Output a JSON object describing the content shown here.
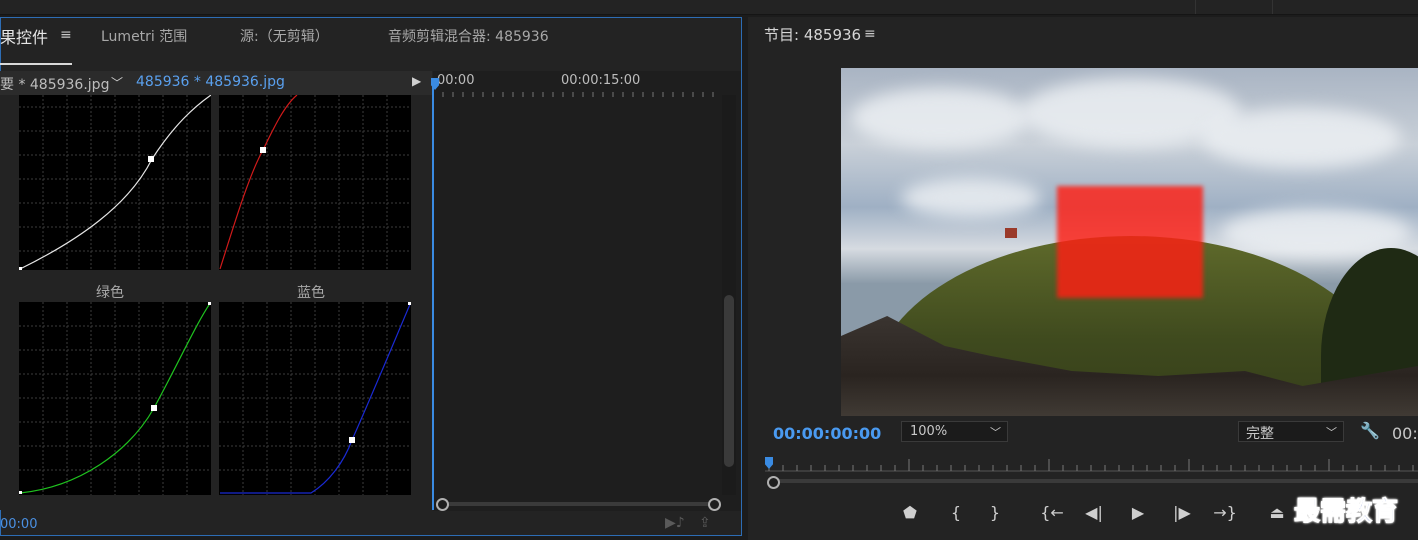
{
  "left_panel": {
    "tabs": [
      {
        "label": "果控件",
        "active": true
      },
      {
        "label": "Lumetri 范围"
      },
      {
        "label": "源:（无剪辑）"
      },
      {
        "label": "音频剪辑混合器: 485936"
      }
    ],
    "menu_icon": "≡",
    "clip_master": "要 * 485936.jpg",
    "clip_sequence": "485936 * 485936.jpg",
    "curves": {
      "green_label": "绿色",
      "blue_label": "蓝色"
    },
    "current_time": "00:00",
    "timeline": {
      "time_start": "00:00",
      "time_mid": "00:00:15:00"
    }
  },
  "program_monitor": {
    "title": "节目: 485936",
    "menu_icon": "≡",
    "timecode": "00:00:00:00",
    "zoom": "100%",
    "quality": "完整",
    "timecode_right": "00:",
    "controls": [
      {
        "name": "add-marker-button",
        "glyph": "⬟"
      },
      {
        "name": "mark-in-button",
        "glyph": "{"
      },
      {
        "name": "mark-out-button",
        "glyph": "}"
      },
      {
        "name": "go-to-in-button",
        "glyph": "{←"
      },
      {
        "name": "step-back-button",
        "glyph": "◀|"
      },
      {
        "name": "play-button",
        "glyph": "▶"
      },
      {
        "name": "step-forward-button",
        "glyph": "|▶"
      },
      {
        "name": "go-to-out-button",
        "glyph": "→}"
      },
      {
        "name": "lift-button",
        "glyph": "⏏"
      }
    ]
  },
  "watermark": "最需教育"
}
